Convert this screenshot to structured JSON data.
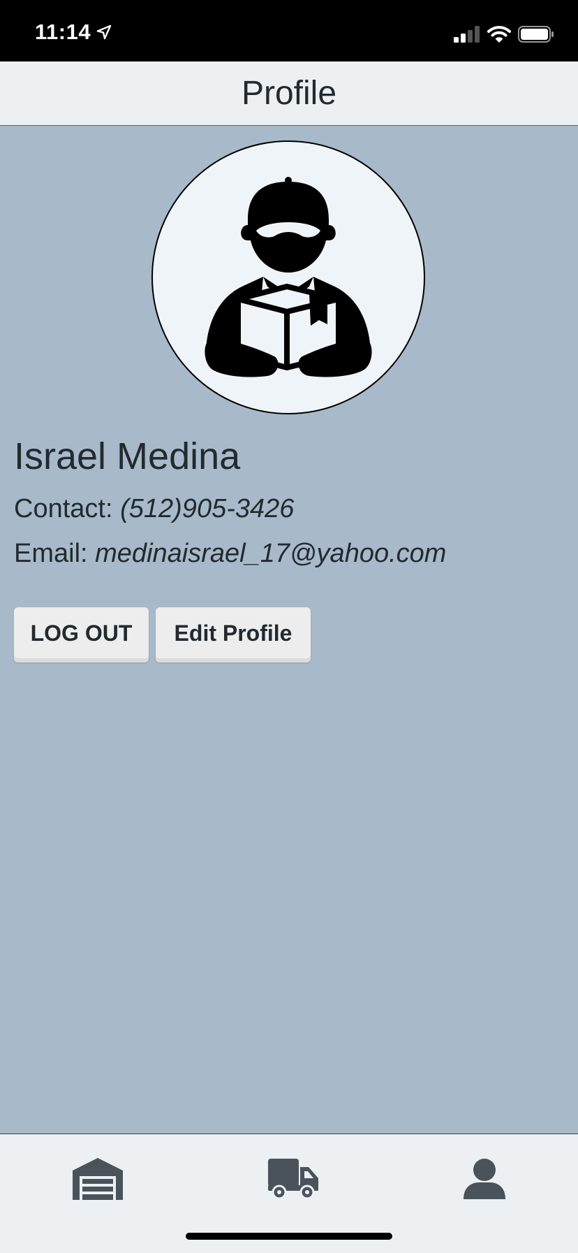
{
  "status_bar": {
    "time": "11:14",
    "location_icon": "location-arrow-icon",
    "signal_icon": "cellular-signal-icon",
    "wifi_icon": "wifi-icon",
    "battery_icon": "battery-icon"
  },
  "header": {
    "title": "Profile"
  },
  "profile": {
    "avatar_icon": "delivery-person-icon",
    "name": "Israel Medina",
    "contact_label": "Contact:",
    "contact_value": "(512)905-3426",
    "email_label": "Email:",
    "email_value": "medinaisrael_17@yahoo.com"
  },
  "actions": {
    "logout_label": "LOG OUT",
    "edit_label": "Edit Profile"
  },
  "tab_bar": {
    "items": [
      {
        "icon": "warehouse-icon"
      },
      {
        "icon": "delivery-truck-icon"
      },
      {
        "icon": "user-icon"
      }
    ]
  },
  "colors": {
    "background": "#a8bac9",
    "header_bg": "#ecf0f3",
    "avatar_bg": "#eff4f8",
    "text": "#222a30",
    "button_bg": "#ededed",
    "tab_icon": "#4a525a"
  }
}
